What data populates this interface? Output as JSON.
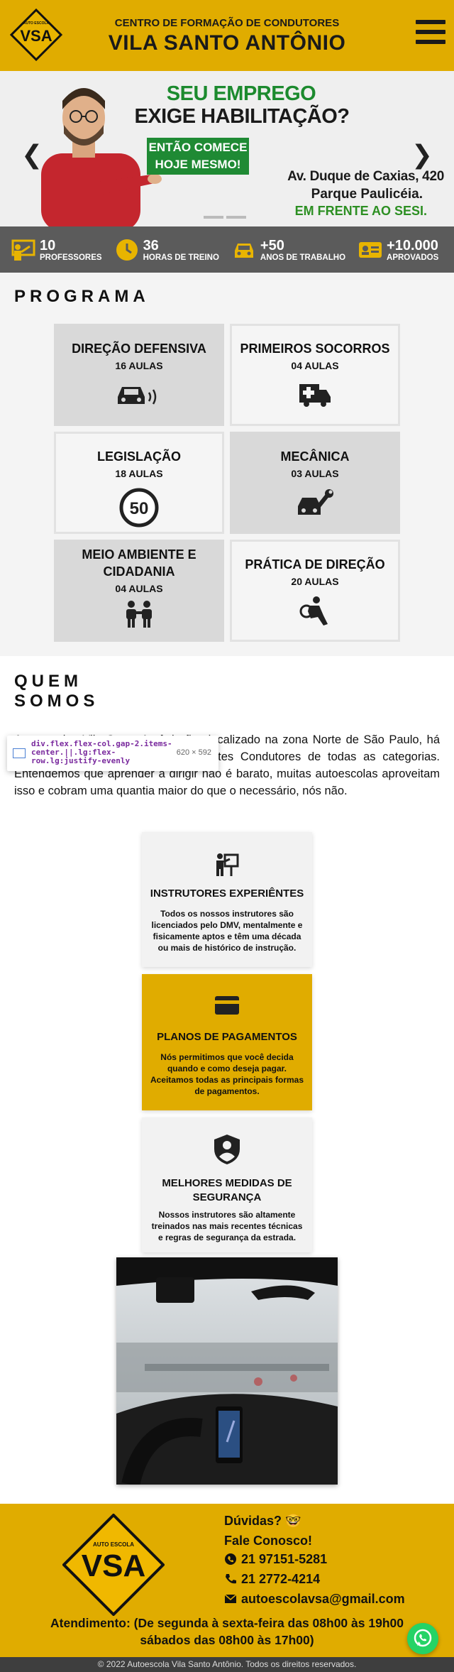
{
  "header": {
    "logo_top_text": "AUTO ESCOLA",
    "logo_text": "VSA",
    "subtitle": "CENTRO DE FORMAÇÃO DE CONDUTORES",
    "title": "VILA SANTO ANTÔNIO",
    "menu_icon": "hamburger-menu-icon"
  },
  "hero": {
    "headline_1": "SEU EMPREGO",
    "headline_2": "EXIGE HABILITAÇÃO?",
    "cta_1": "ENTÃO COMECE",
    "cta_2": "HOJE MESMO!",
    "address_1": "Av. Duque de Caxias, 420",
    "address_2": "Parque Paulicéia.",
    "address_3": "EM FRENTE AO SESI.",
    "prev_arrow": "❮",
    "next_arrow": "❯"
  },
  "stats": [
    {
      "value": "10",
      "label": "PROFESSORES",
      "icon": "teacher-icon"
    },
    {
      "value": "36",
      "label": "HORAS DE TREINO",
      "icon": "clock-icon"
    },
    {
      "value": "+50",
      "label": "ANOS DE TRABALHO",
      "icon": "car-icon"
    },
    {
      "value": "+10.000",
      "label": "APROVADOS",
      "icon": "id-card-icon"
    }
  ],
  "programa": {
    "title": "PROGRAMA",
    "courses": [
      {
        "name": "DIREÇÃO DEFENSIVA",
        "hours": "16 AULAS",
        "icon": "car-sound-icon"
      },
      {
        "name": "PRIMEIROS SOCORROS",
        "hours": "04 AULAS",
        "icon": "ambulance-icon"
      },
      {
        "name": "LEGISLAÇÃO",
        "hours": "18 AULAS",
        "icon": "speed-limit-icon",
        "icon_text": "50"
      },
      {
        "name": "MECÂNICA",
        "hours": "03 AULAS",
        "icon": "car-wrench-icon"
      },
      {
        "name": "MEIO AMBIENTE E",
        "name_2": "CIDADANIA",
        "hours": "04 AULAS",
        "icon": "people-icon"
      },
      {
        "name": "PRÁTICA DE DIREÇÃO",
        "hours": "20 AULAS",
        "icon": "driving-person-icon"
      }
    ]
  },
  "quem": {
    "title_1": "QUEM",
    "title_2": "SOMOS",
    "paragraph": "Autoescolas Vila Santo Antônio fica localizado na zona Norte de São Paulo, há mais de 50 anos, formando excelentes Condutores de todas as categorias. Entendemos que aprender a dirigir não é barato, muitas autoescolas aproveitam isso e cobram uma quantia maior do que o necessário, nós não.",
    "inspector_selector": "div.flex.flex-col.gap-2.items-center.||.lg:flex-row.lg:justify-evenly",
    "inspector_size": "620 × 592",
    "features": [
      {
        "title": "INSTRUTORES EXPERIÊNTES",
        "desc": "Todos os nossos instrutores são licenciados pelo DMV, mentalmente e fisicamente aptos e têm uma década ou mais de histórico de instrução.",
        "icon": "instructor-icon"
      },
      {
        "title": "PLANOS DE PAGAMENTOS",
        "desc": "Nós permitimos que você decida quando e como deseja pagar. Aceitamos todas as principais formas de pagamentos.",
        "icon": "credit-card-icon"
      },
      {
        "title": "MELHORES MEDIDAS DE",
        "title_2": "SEGURANÇA",
        "desc": "Nossos instrutores são altamente treinados nas mais recentes técnicas e regras de segurança da estrada.",
        "icon": "shield-user-icon"
      }
    ]
  },
  "footer": {
    "duvidas": "Dúvidas? 🤓",
    "fale": "Fale Conosco!",
    "whatsapp": "21 97151-5281",
    "phone": "21 2772-4214",
    "email": "autoescolavsa@gmail.com",
    "hours_1": "Atendimento: (De segunda à sexta-feira das 08h00 às 19h00",
    "hours_2": "sábados das 08h00 às 17h00)",
    "copyright": "© 2022 Autoescola Vila Santo Antônio. Todos os direitos reservados."
  },
  "colors": {
    "brand_yellow": "#e0ac00",
    "brand_green": "#1f8a34",
    "stats_gray": "#5b5b5b"
  }
}
